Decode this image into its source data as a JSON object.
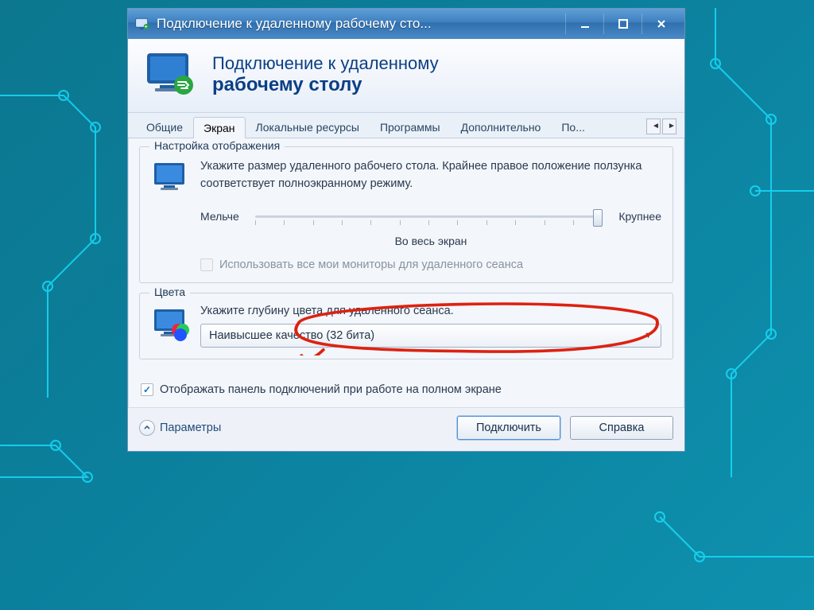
{
  "window": {
    "title": "Подключение к удаленному рабочему сто..."
  },
  "banner": {
    "line1": "Подключение к удаленному",
    "line2": "рабочему столу"
  },
  "tabs": {
    "items": [
      {
        "label": "Общие"
      },
      {
        "label": "Экран"
      },
      {
        "label": "Локальные ресурсы"
      },
      {
        "label": "Программы"
      },
      {
        "label": "Дополнительно"
      },
      {
        "label": "По..."
      }
    ],
    "active_index": 1
  },
  "display_group": {
    "title": "Настройка отображения",
    "desc": "Укажите размер удаленного рабочего стола. Крайнее правое положение ползунка соответствует полноэкранному режиму.",
    "slider_min_label": "Мельче",
    "slider_max_label": "Крупнее",
    "slider_caption": "Во весь экран",
    "all_monitors_label": "Использовать все мои мониторы для удаленного сеанса"
  },
  "colors_group": {
    "title": "Цвета",
    "desc": "Укажите глубину цвета для удаленного сеанса.",
    "selected": "Наивысшее качество (32 бита)"
  },
  "footer": {
    "show_bar_label": "Отображать панель подключений при работе на полном экране",
    "options_label": "Параметры",
    "connect_label": "Подключить",
    "help_label": "Справка"
  }
}
